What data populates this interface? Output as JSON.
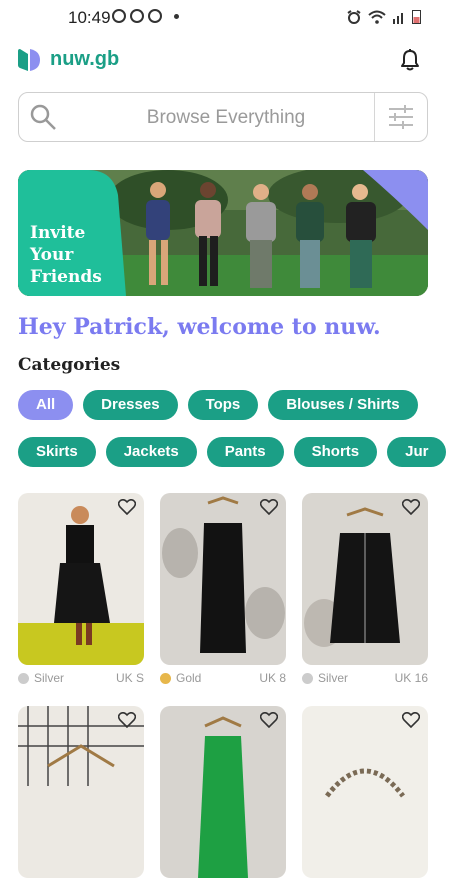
{
  "status": {
    "time": "10:49"
  },
  "app": {
    "name": "nuw.gb"
  },
  "search": {
    "placeholder": "Browse Everything"
  },
  "banner": {
    "line1": "Invite",
    "line2": "Your",
    "line3": "Friends"
  },
  "welcome": "Hey Patrick, welcome to nuw.",
  "categories_title": "Categories",
  "categories_row1": [
    "All",
    "Dresses",
    "Tops",
    "Blouses / Shirts"
  ],
  "categories_row2": [
    "Skirts",
    "Jackets",
    "Pants",
    "Shorts",
    "Jur"
  ],
  "products": [
    {
      "metal": "Silver",
      "size": "UK S",
      "dot": "#cccccc"
    },
    {
      "metal": "Gold",
      "size": "UK 8",
      "dot": "#e7b74b"
    },
    {
      "metal": "Silver",
      "size": "UK 16",
      "dot": "#cccccc"
    }
  ],
  "colors": {
    "accent": "#1b9f86",
    "active_chip": "#8c8ff0",
    "welcome": "#7b7bf0"
  }
}
